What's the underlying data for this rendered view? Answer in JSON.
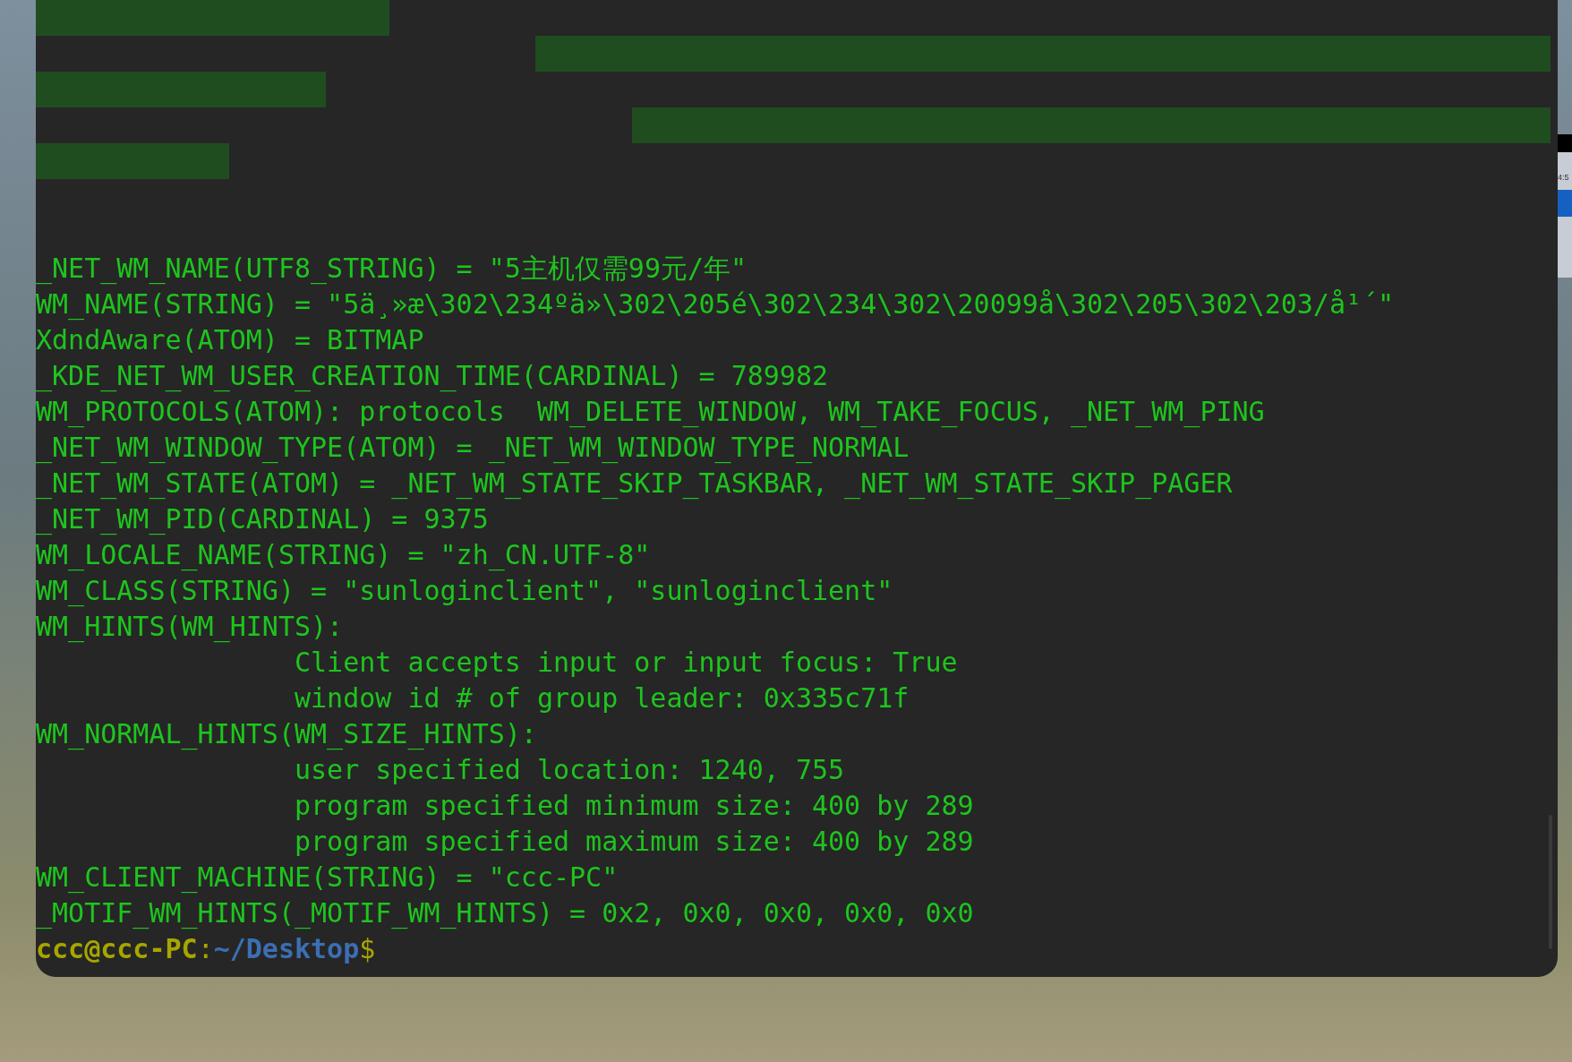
{
  "terminal": {
    "lines": [
      {
        "text": "_NET_WM_NAME(UTF8_STRING) = \"5主机仅需99元/年\"",
        "indent": false
      },
      {
        "text": "WM_NAME(STRING) = \"5ä¸»æ\\302\\234ºä»\\302\\205é\\302\\234\\302\\20099å\\302\\205\\302\\203/å¹´\"",
        "indent": false
      },
      {
        "text": "XdndAware(ATOM) = BITMAP",
        "indent": false
      },
      {
        "text": "_KDE_NET_WM_USER_CREATION_TIME(CARDINAL) = 789982",
        "indent": false
      },
      {
        "text": "WM_PROTOCOLS(ATOM): protocols  WM_DELETE_WINDOW, WM_TAKE_FOCUS, _NET_WM_PING",
        "indent": false
      },
      {
        "text": "_NET_WM_WINDOW_TYPE(ATOM) = _NET_WM_WINDOW_TYPE_NORMAL",
        "indent": false
      },
      {
        "text": "_NET_WM_STATE(ATOM) = _NET_WM_STATE_SKIP_TASKBAR, _NET_WM_STATE_SKIP_PAGER",
        "indent": false
      },
      {
        "text": "_NET_WM_PID(CARDINAL) = 9375",
        "indent": false
      },
      {
        "text": "WM_LOCALE_NAME(STRING) = \"zh_CN.UTF-8\"",
        "indent": false
      },
      {
        "text": "WM_CLASS(STRING) = \"sunloginclient\", \"sunloginclient\"",
        "indent": false
      },
      {
        "text": "WM_HINTS(WM_HINTS):",
        "indent": false
      },
      {
        "text": "Client accepts input or input focus: True",
        "indent": true
      },
      {
        "text": "window id # of group leader: 0x335c71f",
        "indent": true
      },
      {
        "text": "WM_NORMAL_HINTS(WM_SIZE_HINTS):",
        "indent": false
      },
      {
        "text": "user specified location: 1240, 755",
        "indent": true
      },
      {
        "text": "program specified minimum size: 400 by 289",
        "indent": true
      },
      {
        "text": "program specified maximum size: 400 by 289",
        "indent": true
      },
      {
        "text": "WM_CLIENT_MACHINE(STRING) = \"ccc-PC\"",
        "indent": false
      },
      {
        "text": "_MOTIF_WM_HINTS(_MOTIF_WM_HINTS) = 0x2, 0x0, 0x0, 0x0, 0x0",
        "indent": false
      }
    ],
    "prompt": {
      "user_host": "ccc@ccc-PC",
      "separator": ":",
      "path": "~/Desktop",
      "symbol": "$"
    }
  },
  "side_window": {
    "text": "4:5"
  }
}
